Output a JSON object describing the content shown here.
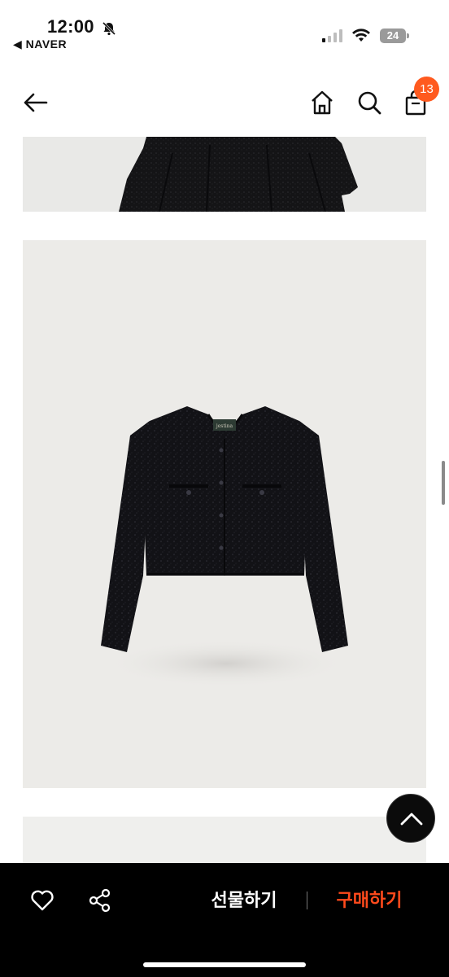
{
  "status_bar": {
    "time": "12:00",
    "back_app": "◀ NAVER",
    "battery": "24"
  },
  "header": {
    "cart_count": "13"
  },
  "icons": {
    "back": "arrow-left-icon",
    "home": "home-icon",
    "search": "search-icon",
    "bag": "shopping-bag-icon",
    "like": "heart-icon",
    "share": "share-icon",
    "scroll_top": "chevron-up-icon"
  },
  "images": {
    "brand_label": "jestina"
  },
  "bottom_bar": {
    "gift_label": "선물하기",
    "buy_label": "구매하기"
  },
  "colors": {
    "accent": "#ff5a1f",
    "buy_text": "#ff4a1c",
    "bar_bg": "#000000"
  }
}
